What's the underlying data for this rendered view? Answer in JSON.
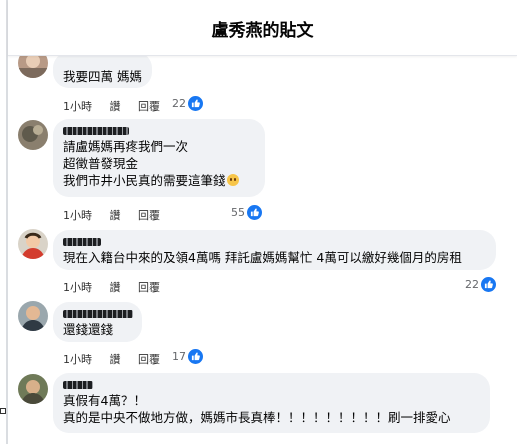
{
  "header": {
    "title": "盧秀燕的貼文"
  },
  "comments": [
    {
      "lines": [
        "我要四萬 媽媽"
      ],
      "time": "1小時",
      "like_label": "讚",
      "reply_label": "回覆",
      "reactions": "22"
    },
    {
      "lines": [
        "請盧媽媽再疼我們一次",
        "超徵普發現金",
        "我們市井小民真的需要這筆錢"
      ],
      "time": "1小時",
      "like_label": "讚",
      "reply_label": "回覆",
      "reactions": "55",
      "emoji": "pleading-face"
    },
    {
      "lines": [
        "現在入籍台中來的及領4萬嗎 拜託盧媽媽幫忙 4萬可以繳好幾個月的房租"
      ],
      "time": "1小時",
      "like_label": "讚",
      "reply_label": "回覆",
      "reactions": "22"
    },
    {
      "lines": [
        "還錢還錢"
      ],
      "time": "1小時",
      "like_label": "讚",
      "reply_label": "回覆",
      "reactions": "17"
    },
    {
      "lines": [
        "真假有4萬？！",
        "真的是中央不做地方做，媽媽市長真棒！！！！！！！！！刷一排愛心"
      ]
    }
  ],
  "colors": {
    "like_blue": "#1877f2",
    "bubble_bg": "#f0f2f5"
  },
  "icons": [
    "like-icon",
    "avatar"
  ]
}
